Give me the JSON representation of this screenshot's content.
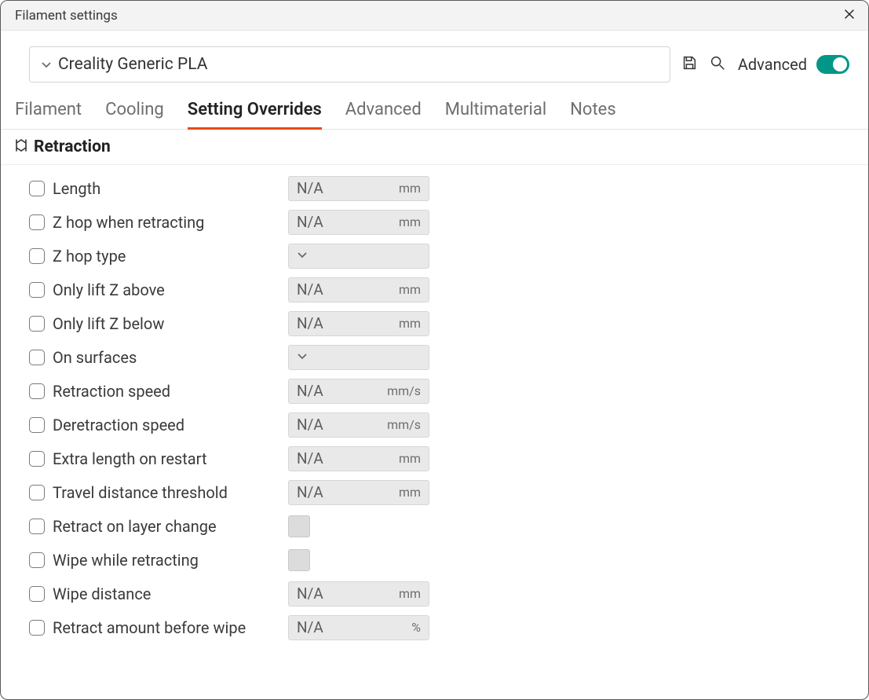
{
  "window": {
    "title": "Filament settings"
  },
  "toolbar": {
    "preset_name": "Creality Generic PLA",
    "advanced_label": "Advanced",
    "advanced_on": true
  },
  "tabs": [
    {
      "id": "filament",
      "label": "Filament",
      "active": false
    },
    {
      "id": "cooling",
      "label": "Cooling",
      "active": false
    },
    {
      "id": "overrides",
      "label": "Setting Overrides",
      "active": true
    },
    {
      "id": "advanced",
      "label": "Advanced",
      "active": false
    },
    {
      "id": "multimaterial",
      "label": "Multimaterial",
      "active": false
    },
    {
      "id": "notes",
      "label": "Notes",
      "active": false
    }
  ],
  "section": {
    "title": "Retraction"
  },
  "rows": [
    {
      "id": "length",
      "label": "Length",
      "type": "num",
      "value": "N/A",
      "unit": "mm"
    },
    {
      "id": "zhop-retract",
      "label": "Z hop when retracting",
      "type": "num",
      "value": "N/A",
      "unit": "mm"
    },
    {
      "id": "zhop-type",
      "label": "Z hop type",
      "type": "select",
      "value": ""
    },
    {
      "id": "lift-above",
      "label": "Only lift Z above",
      "type": "num",
      "value": "N/A",
      "unit": "mm"
    },
    {
      "id": "lift-below",
      "label": "Only lift Z below",
      "type": "num",
      "value": "N/A",
      "unit": "mm"
    },
    {
      "id": "on-surfaces",
      "label": "On surfaces",
      "type": "select",
      "value": ""
    },
    {
      "id": "retract-speed",
      "label": "Retraction speed",
      "type": "num",
      "value": "N/A",
      "unit": "mm/s"
    },
    {
      "id": "deretract-speed",
      "label": "Deretraction speed",
      "type": "num",
      "value": "N/A",
      "unit": "mm/s"
    },
    {
      "id": "extra-restart",
      "label": "Extra length on restart",
      "type": "num",
      "value": "N/A",
      "unit": "mm"
    },
    {
      "id": "travel-thresh",
      "label": "Travel distance threshold",
      "type": "num",
      "value": "N/A",
      "unit": "mm"
    },
    {
      "id": "retract-layer",
      "label": "Retract on layer change",
      "type": "bool"
    },
    {
      "id": "wipe-retract",
      "label": "Wipe while retracting",
      "type": "bool"
    },
    {
      "id": "wipe-dist",
      "label": "Wipe distance",
      "type": "num",
      "value": "N/A",
      "unit": "mm"
    },
    {
      "id": "retract-before-wipe",
      "label": "Retract amount before wipe",
      "type": "num",
      "value": "N/A",
      "unit": "%"
    }
  ]
}
